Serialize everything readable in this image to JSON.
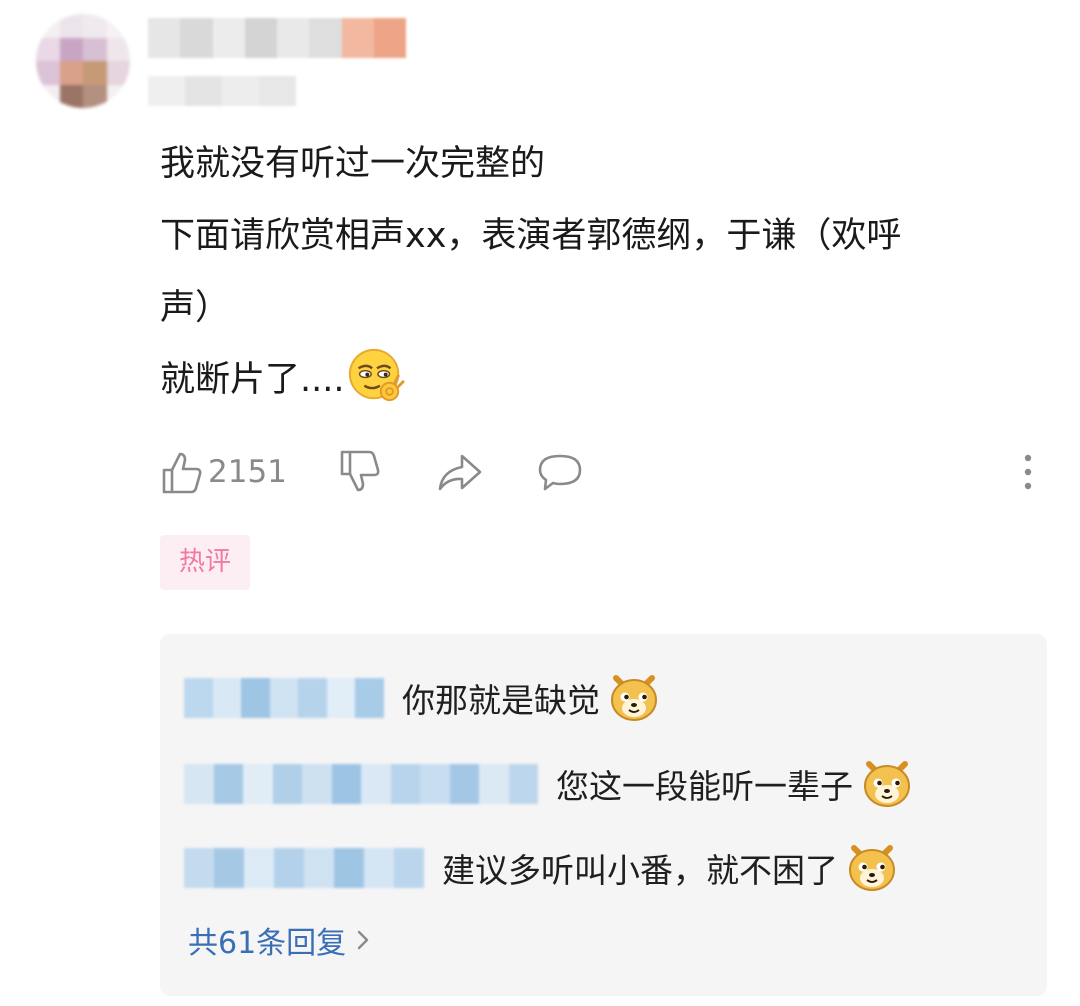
{
  "comment": {
    "lines": [
      "我就没有听过一次完整的",
      "下面请欣赏相声xx，表演者郭德纲，于谦（欢呼",
      "声）",
      "就断片了...."
    ],
    "emoji": "smirk-ok-emoji",
    "like_count": "2151",
    "tag": "热评"
  },
  "replies": [
    {
      "text": "你那就是缺觉",
      "emoji": "doge-emoji"
    },
    {
      "text": "您这一段能听一辈子",
      "emoji": "doge-emoji"
    },
    {
      "text": "建议多听叫小番，就不困了",
      "emoji": "doge-emoji"
    }
  ],
  "more_replies_label": "共61条回复",
  "colors": {
    "tag_bg": "#fdeef3",
    "tag_text": "#f17aa0",
    "link": "#3a6fb5",
    "reply_bg": "#f5f5f6",
    "meta_gray": "#8a8a8a"
  }
}
